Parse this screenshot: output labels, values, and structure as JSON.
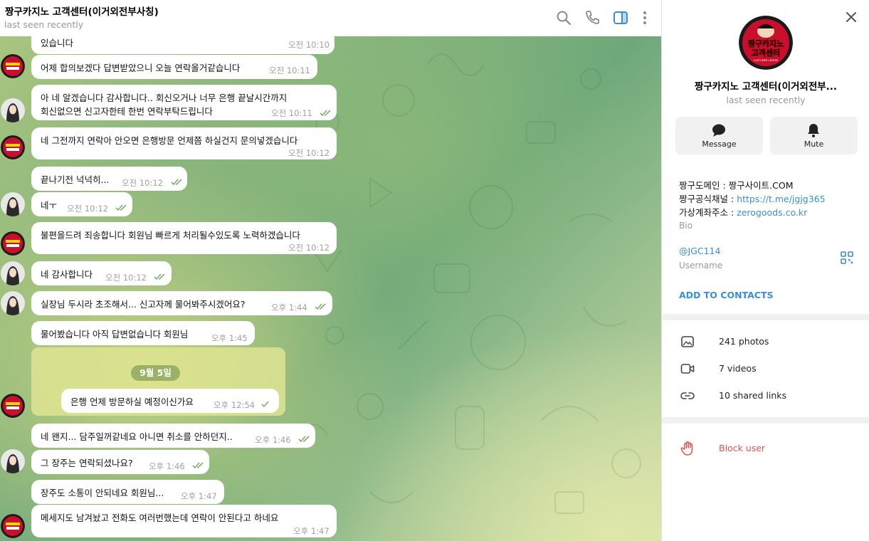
{
  "header": {
    "title": "짱구카지노 고객센터(이거외전부사칭)",
    "status": "last seen recently"
  },
  "icons": [
    "search-icon",
    "phone-icon",
    "sidebar-toggle-icon",
    "more-vert-icon"
  ],
  "messages": [
    {
      "id": "m1",
      "text": "있습니다",
      "time": "오전 10:10",
      "read": false
    },
    {
      "id": "m2",
      "text": "어제 합의보겠다 답변받았으니 오늘 연락올거같습니다",
      "time": "오전 10:11",
      "read": false
    },
    {
      "id": "m3",
      "text": "아 네 알겠습니다 감사합니다.. 회신오거나 너무 은행 끝날시간까지",
      "text2": "회신없으면 신고자한테 한번 연락부탁드립니다",
      "time": "오전 10:11",
      "read": true
    },
    {
      "id": "m4",
      "text": "네 그전까지 연락아 안오면 은행방문 언제쯤 하실건지 문의넣겠습니다",
      "time": "오전 10:12",
      "read": false
    },
    {
      "id": "m5",
      "text": "끝나기전 넉넉히...",
      "time": "오전 10:12",
      "read": true
    },
    {
      "id": "m6",
      "text": "네ㅜ",
      "time": "오전 10:12",
      "read": true
    },
    {
      "id": "m7",
      "text": "불편을드려 죄송합니다 회원님 빠르게 처리될수있도록 노력하겠습니다",
      "time": "오전 10:12",
      "read": false
    },
    {
      "id": "m8",
      "text": "네 감사합니다",
      "time": "오전 10:12",
      "read": true
    },
    {
      "id": "m9",
      "text": "실장님 두시라 초조해서... 신고자께 물어봐주시겠어요?",
      "time": "오후 1:44",
      "read": true
    },
    {
      "id": "m10",
      "text": "물어봤습니다 아직 답변없습니다 회원님",
      "time": "오후 1:45",
      "read": false
    },
    {
      "id": "m11",
      "text": "은행 언제 방문하실 예정이신가요",
      "time": "오후 12:54",
      "read": true
    },
    {
      "id": "m12",
      "text": "네 왠지... 담주일꺼같네요 아니면 취소를 안하던지..",
      "time": "오후 1:46",
      "read": true
    },
    {
      "id": "m13",
      "text": "그 장주는 연락되셨나요?",
      "time": "오후 1:46",
      "read": true
    },
    {
      "id": "m14",
      "text": "장주도 소통이 안되네요 회원님...",
      "time": "오후 1:47",
      "read": false
    },
    {
      "id": "m15",
      "text": "메세지도 남겨놨고 전화도 여러번했는데 연락이 안된다고 하네요",
      "time": "오후 1:47",
      "read": false
    }
  ],
  "date_separator": "9월 5일",
  "avatars": {
    "logo_text_top": "짱구카지노",
    "logo_text_bottom": "고객센터",
    "logo_caption": "CUSTOMER CENTER"
  },
  "panel": {
    "name": "짱구카지노 고객센터(이거외전부...",
    "status": "last seen recently",
    "message_label": "Message",
    "mute_label": "Mute",
    "bio_lines": [
      {
        "label": "짱구도메인 : ",
        "value": "짱구사이트.COM"
      },
      {
        "label": "짱구공식채널 : ",
        "value": "https://t.me/jgjg365"
      },
      {
        "label": "가상계좌주소 : ",
        "value": "zerogoods.co.kr"
      }
    ],
    "bio_caption": "Bio",
    "username": "@JGC114",
    "username_caption": "Username",
    "add_contacts": "ADD TO CONTACTS",
    "photos": "241 photos",
    "videos": "7 videos",
    "links": "10 shared links",
    "block": "Block user"
  },
  "colors": {
    "accent": "#3a8fd0",
    "outgoing_bubble": "#eefed9",
    "incoming_bubble": "#ffffff",
    "danger": "#d9534f",
    "logo_red": "#c8102e"
  }
}
